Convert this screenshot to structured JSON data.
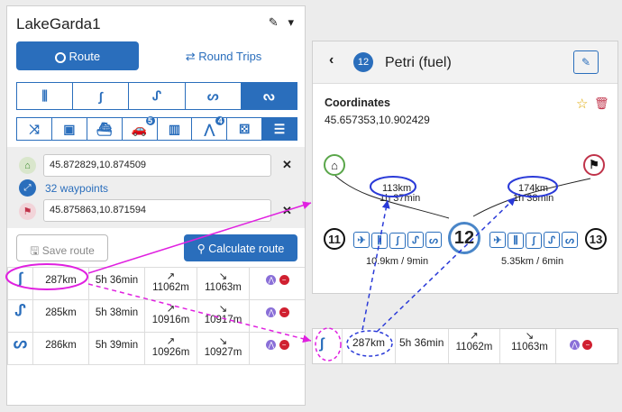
{
  "panel": {
    "title": "LakeGarda1",
    "tab_route": "Route",
    "tab_round_trips": "Round Trips",
    "start": "45.872829,10.874509",
    "waypoints": "32 waypoints",
    "end": "45.875863,10.871594",
    "save_route": "Save route",
    "calculate_route": "Calculate route",
    "badge_scooter": "5",
    "badge_curves": "4"
  },
  "routes": [
    {
      "distance": "287km",
      "duration": "5h 36min",
      "ascent": "11062m",
      "descent": "11063m",
      "icon_color": "#2a6ebc"
    },
    {
      "distance": "285km",
      "duration": "5h 38min",
      "ascent": "10916m",
      "descent": "10917m",
      "icon_color": "#2a6ebc"
    },
    {
      "distance": "286km",
      "duration": "5h 39min",
      "ascent": "10926m",
      "descent": "10927m",
      "icon_color": "#2a6ebc"
    }
  ],
  "arrows": {
    "up": "↗",
    "down": "↘"
  },
  "poi": {
    "number": "12",
    "name": "Petri (fuel)",
    "coords_label": "Coordinates",
    "coords": "45.657353,10.902429",
    "left_dist": "113km",
    "left_time": "1h 37min",
    "right_dist": "174km",
    "right_time": "1h 38min",
    "pin_prev": "11",
    "pin_cur": "12",
    "pin_next": "13",
    "seg_left": "10.9km / 9min",
    "seg_right": "5.35km / 6min"
  },
  "zoom_row": {
    "distance": "287km",
    "duration": "5h 36min",
    "ascent": "11062m",
    "descent": "11063m"
  }
}
